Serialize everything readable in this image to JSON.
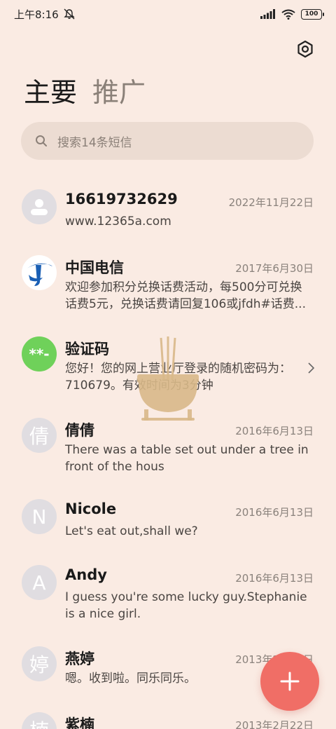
{
  "status_bar": {
    "time": "上午8:16",
    "battery": "100"
  },
  "tabs": [
    {
      "label": "主要",
      "active": true
    },
    {
      "label": "推广",
      "active": false
    }
  ],
  "search": {
    "placeholder": "搜索14条短信"
  },
  "messages": [
    {
      "sender": "16619732629",
      "date": "2022年11月22日",
      "preview": "www.12365a.com",
      "avatar": "person-icon"
    },
    {
      "sender": "中国电信",
      "date": "2017年6月30日",
      "preview": "欢迎参加积分兑换话费活动，每500分可兑换话费5元，兑换话费请回复106或jfdh#话费...",
      "avatar": "china-telecom-logo"
    },
    {
      "sender": "验证码",
      "date": "",
      "preview": "您好！您的网上营业厅登录的随机密码为：710679。有效时间为3分钟",
      "avatar": "**-"
    },
    {
      "sender": "倩倩",
      "date": "2016年6月13日",
      "preview": "There was a table set out under a tree in front of the hous",
      "avatar": "倩"
    },
    {
      "sender": "Nicole",
      "date": "2016年6月13日",
      "preview": "Let's eat out,shall we?",
      "avatar": "N"
    },
    {
      "sender": "Andy",
      "date": "2016年6月13日",
      "preview": "I guess you're some lucky guy.Stephanie is a nice girl.",
      "avatar": "A"
    },
    {
      "sender": "燕婷",
      "date": "2013年2月22日",
      "preview": "嗯。收到啦。同乐同乐。",
      "avatar": "婷"
    },
    {
      "sender": "紫楠",
      "date": "2013年2月22日",
      "preview": "",
      "avatar": "楠"
    }
  ],
  "colors": {
    "background": "#faebe3",
    "fab": "#f06e66",
    "verify_avatar": "#6fd15a"
  }
}
